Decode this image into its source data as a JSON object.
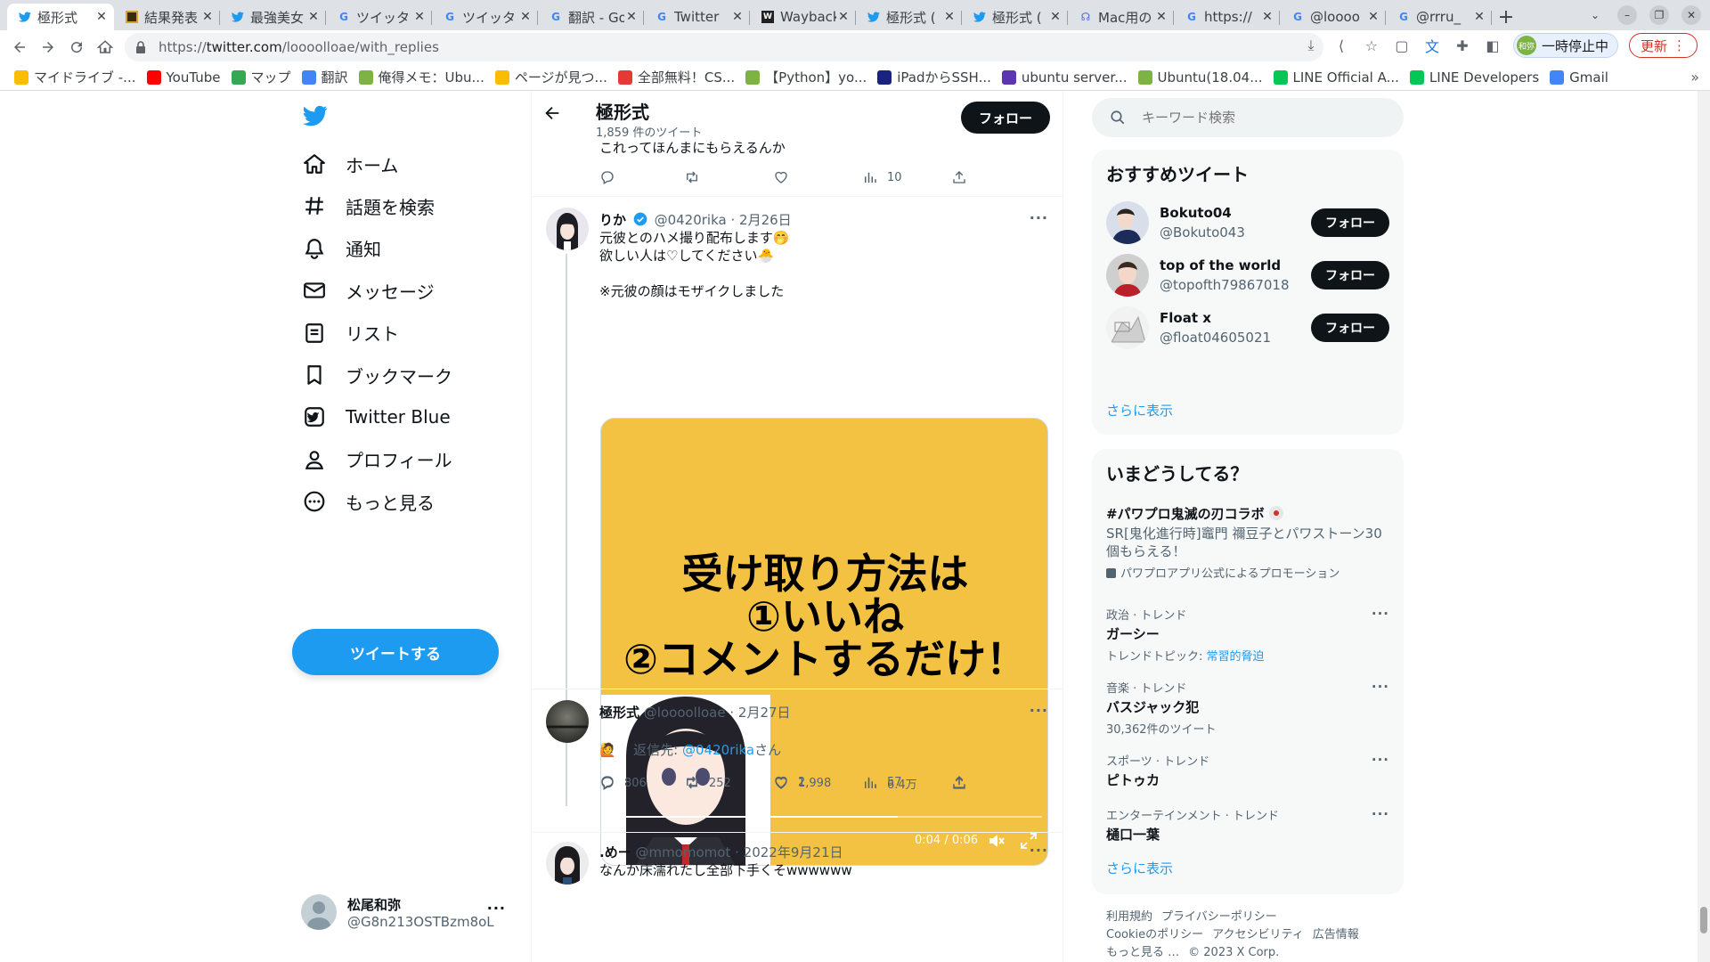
{
  "browser": {
    "tabs": [
      {
        "title": "極形式",
        "icon": "twitter",
        "active": true
      },
      {
        "title": "結果発表",
        "icon": "site"
      },
      {
        "title": "最強美女",
        "icon": "twitter"
      },
      {
        "title": "ツイッタ",
        "icon": "google"
      },
      {
        "title": "ツイッタ",
        "icon": "google"
      },
      {
        "title": "翻訳 - Go",
        "icon": "google"
      },
      {
        "title": "Twitter",
        "icon": "google"
      },
      {
        "title": "Wayback",
        "icon": "wayback"
      },
      {
        "title": "極形式 (",
        "icon": "twitter"
      },
      {
        "title": "極形式 (",
        "icon": "twitter"
      },
      {
        "title": "Mac用の",
        "icon": "misc"
      },
      {
        "title": "https://",
        "icon": "google"
      },
      {
        "title": "@loooo",
        "icon": "google"
      },
      {
        "title": "@rrru_",
        "icon": "google"
      }
    ],
    "url": {
      "scheme": "https://",
      "host": "twitter.com",
      "path": "/loooolloae/with_replies"
    },
    "profile_button": {
      "avatar_text": "和弥",
      "label": "一時停止中"
    },
    "update_button": "更新",
    "bookmarks": [
      {
        "label": "マイドライブ -...",
        "color": "#fbbc04"
      },
      {
        "label": "YouTube",
        "color": "#ff0000"
      },
      {
        "label": "マップ",
        "color": "#34a853"
      },
      {
        "label": "翻訳",
        "color": "#4285f4"
      },
      {
        "label": "俺得メモ：Ubu...",
        "color": "#7cb342"
      },
      {
        "label": "ページが見つ...",
        "color": "#fbbc04"
      },
      {
        "label": "全部無料！CS...",
        "color": "#e53935"
      },
      {
        "label": "【Python】yo...",
        "color": "#7cb342"
      },
      {
        "label": "iPadからSSH...",
        "color": "#1a237e"
      },
      {
        "label": "ubuntu server...",
        "color": "#5e35b1"
      },
      {
        "label": "Ubuntu(18.04...",
        "color": "#7cb342"
      },
      {
        "label": "LINE Official A...",
        "color": "#06c755"
      },
      {
        "label": "LINE Developers",
        "color": "#06c755"
      },
      {
        "label": "Gmail",
        "color": "#4285f4"
      }
    ]
  },
  "nav": {
    "items": [
      {
        "label": "ホーム",
        "icon": "home-icon"
      },
      {
        "label": "話題を検索",
        "icon": "hashtag-icon"
      },
      {
        "label": "通知",
        "icon": "bell-icon"
      },
      {
        "label": "メッセージ",
        "icon": "envelope-icon"
      },
      {
        "label": "リスト",
        "icon": "list-icon"
      },
      {
        "label": "ブックマーク",
        "icon": "bookmark-icon"
      },
      {
        "label": "Twitter Blue",
        "icon": "twitter-blue-icon"
      },
      {
        "label": "プロフィール",
        "icon": "person-icon"
      },
      {
        "label": "もっと見る",
        "icon": "more-circle-icon"
      }
    ],
    "tweet_button": "ツイートする",
    "account": {
      "name": "松尾和弥",
      "handle": "@G8n213OSTBzm8oL"
    }
  },
  "header": {
    "title": "極形式",
    "tweet_count": "1,859 件のツイート",
    "follow": "フォロー"
  },
  "tweets": [
    {
      "text": "これってほんまにもらえるんか",
      "reply": "",
      "retweet": "",
      "like": "",
      "views": "10"
    },
    {
      "name": "りか",
      "verified": true,
      "handle": "@0420rika",
      "date": "· 2月26日",
      "text": "元彼とのハメ撮り配布します🤭\n欲しい人は♡してください🐣\n\n※元彼の顔はモザイクしました",
      "media": {
        "overlay_text": "受け取り方法は\n①いいね\n②コメントするだけ！",
        "time": "0:04 / 0:06",
        "progress": 0.667
      },
      "reply": "806",
      "retweet": "252",
      "like": "1,998",
      "views": "6.4万"
    },
    {
      "name": "極形式",
      "handle": "@loooolloae",
      "date": "· 2月27日",
      "reply_to_prefix": "返信先: ",
      "reply_to": "@0420rika",
      "reply_to_suffix": "さん",
      "text": "🙋",
      "reply": "",
      "retweet": "",
      "like": "2",
      "views": "57"
    },
    {
      "name": ".めー",
      "handle": "@mmomomot",
      "date": "· 2022年9月21日",
      "text": "なんか床濡れたし全部下手くそwwwwww"
    }
  ],
  "right": {
    "search_placeholder": "キーワード検索",
    "suggest_title": "おすすめツイート",
    "suggestions": [
      {
        "name": "Bokuto04",
        "handle": "@Bokuto043",
        "button": "フォロー"
      },
      {
        "name": "top of the world",
        "handle": "@topofth79867018",
        "button": "フォロー"
      },
      {
        "name": "Float x",
        "handle": "@float04605021",
        "button": "フォロー"
      }
    ],
    "suggest_more": "さらに表示",
    "trends_title": "いまどうしてる？",
    "promo": {
      "name": "#パワプロ鬼滅の刃コラボ",
      "desc": "SR[鬼化進行時]竈門 禰豆子とパワストーン30個もらえる！",
      "by": "パワプロアプリ公式によるプロモーション"
    },
    "trends": [
      {
        "meta": "政治 · トレンド",
        "name": "ガーシー",
        "sub_prefix": "トレンドトピック: ",
        "sub_link": "常習的脅迫",
        "sub": ""
      },
      {
        "meta": "音楽 · トレンド",
        "name": "バスジャック犯",
        "sub": "30,362件のツイート"
      },
      {
        "meta": "スポーツ · トレンド",
        "name": "ピトゥカ",
        "sub": ""
      },
      {
        "meta": "エンターテインメント · トレンド",
        "name": "樋口一葉",
        "sub": ""
      }
    ],
    "trends_more": "さらに表示",
    "footer": {
      "line1": [
        "利用規約",
        "プライバシーポリシー"
      ],
      "line2": [
        "Cookieのポリシー",
        "アクセシビリティ",
        "広告情報"
      ],
      "line3": [
        "もっと見る …",
        "© 2023 X Corp."
      ]
    }
  },
  "colors": {
    "accent": "#1d9bf0",
    "text": "#0f1419",
    "muted": "#536471",
    "media_bg": "#f4c242"
  }
}
